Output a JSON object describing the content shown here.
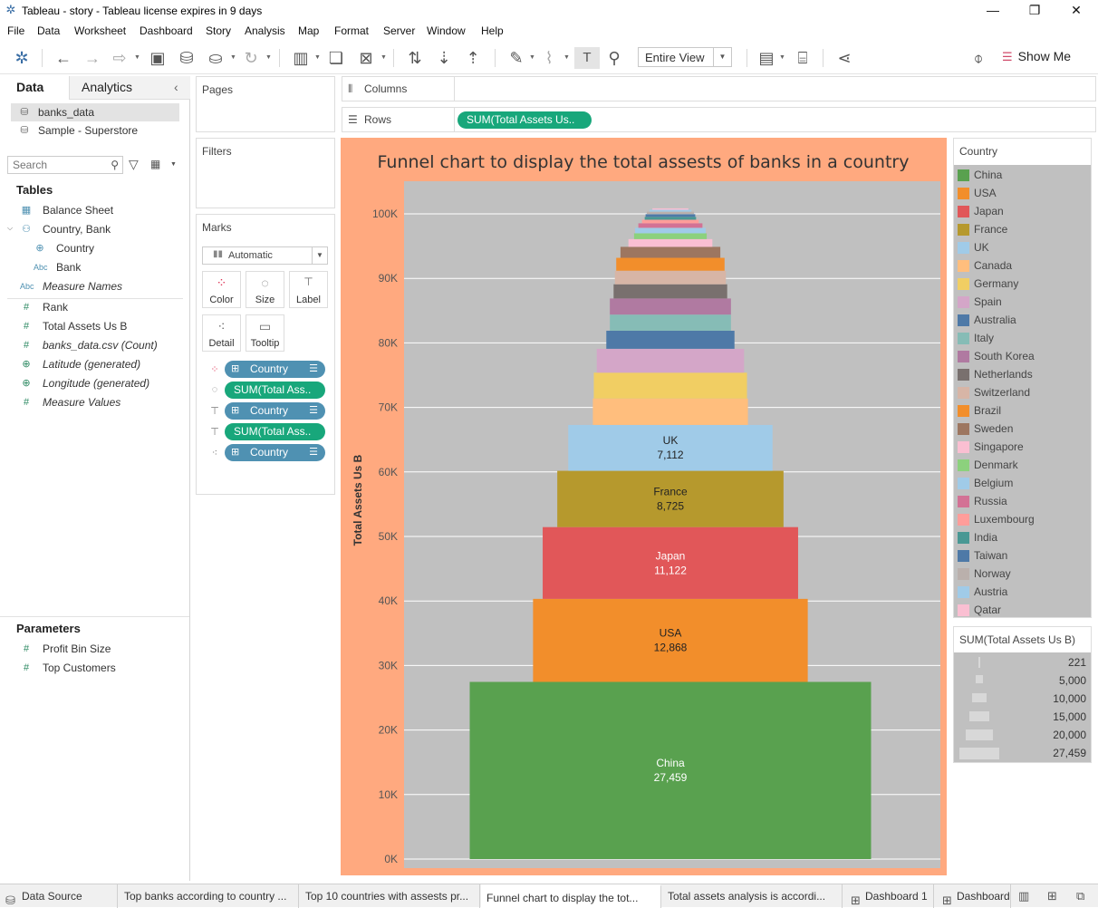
{
  "window": {
    "title": "Tableau - story - Tableau license expires in 9 days",
    "logo_icon": "tableau-logo-icon"
  },
  "menu": [
    "File",
    "Data",
    "Worksheet",
    "Dashboard",
    "Story",
    "Analysis",
    "Map",
    "Format",
    "Server",
    "Window",
    "Help"
  ],
  "toolbar": {
    "fit_value": "Entire View",
    "show_me": "Show Me"
  },
  "datapane": {
    "tabs": [
      "Data",
      "Analytics"
    ],
    "datasources": [
      "banks_data",
      "Sample - Superstore"
    ],
    "search_placeholder": "Search",
    "tables_title": "Tables",
    "fields": [
      {
        "label": "Balance Sheet",
        "icon": "table-icon",
        "italic": false
      },
      {
        "label": "Country, Bank",
        "icon": "hierarchy-icon",
        "italic": false
      },
      {
        "label": "Country",
        "icon": "globe-icon",
        "italic": false
      },
      {
        "label": "Bank",
        "icon": "abc-icon",
        "italic": false
      },
      {
        "label": "Measure Names",
        "icon": "abc-icon",
        "italic": true
      },
      {
        "label": "Rank",
        "icon": "number-icon",
        "italic": false
      },
      {
        "label": "Total Assets Us B",
        "icon": "number-icon",
        "italic": false
      },
      {
        "label": "banks_data.csv (Count)",
        "icon": "number-icon",
        "italic": true
      },
      {
        "label": "Latitude (generated)",
        "icon": "globe-icon",
        "italic": true
      },
      {
        "label": "Longitude (generated)",
        "icon": "globe-icon",
        "italic": true
      },
      {
        "label": "Measure Values",
        "icon": "number-icon",
        "italic": true
      }
    ],
    "parameters_title": "Parameters",
    "parameters": [
      "Profit Bin Size",
      "Top Customers"
    ]
  },
  "shelves": {
    "pages": "Pages",
    "filters": "Filters",
    "marks": "Marks",
    "columns": "Columns",
    "rows": "Rows",
    "rows_pill": "SUM(Total Assets Us..",
    "mark_type": "Automatic",
    "mark_buttons": [
      "Color",
      "Size",
      "Label",
      "Detail",
      "Tooltip"
    ],
    "mark_pills": [
      {
        "label": "Country",
        "kind": "blue",
        "icon": "color-icon"
      },
      {
        "label": "SUM(Total Ass..",
        "kind": "green",
        "icon": "size-icon"
      },
      {
        "label": "Country",
        "kind": "blue",
        "icon": "label-icon"
      },
      {
        "label": "SUM(Total Ass..",
        "kind": "green",
        "icon": "label-icon"
      },
      {
        "label": "Country",
        "kind": "blue",
        "icon": "detail-icon"
      }
    ]
  },
  "legend": {
    "title": "Country",
    "items": [
      {
        "name": "China",
        "color": "#59a14f"
      },
      {
        "name": "USA",
        "color": "#f28e2b"
      },
      {
        "name": "Japan",
        "color": "#e15759"
      },
      {
        "name": "France",
        "color": "#b6992d"
      },
      {
        "name": "UK",
        "color": "#a0cbe8"
      },
      {
        "name": "Canada",
        "color": "#ffbe7d"
      },
      {
        "name": "Germany",
        "color": "#f1ce63"
      },
      {
        "name": "Spain",
        "color": "#d4a6c8"
      },
      {
        "name": "Australia",
        "color": "#4e79a7"
      },
      {
        "name": "Italy",
        "color": "#86bcb6"
      },
      {
        "name": "South Korea",
        "color": "#b07aa1"
      },
      {
        "name": "Netherlands",
        "color": "#79706e"
      },
      {
        "name": "Switzerland",
        "color": "#d7b5a6"
      },
      {
        "name": "Brazil",
        "color": "#f28e2b"
      },
      {
        "name": "Sweden",
        "color": "#9d7660"
      },
      {
        "name": "Singapore",
        "color": "#fabfd2"
      },
      {
        "name": "Denmark",
        "color": "#8cd17d"
      },
      {
        "name": "Belgium",
        "color": "#a0cbe8"
      },
      {
        "name": "Russia",
        "color": "#d37295"
      },
      {
        "name": "Luxembourg",
        "color": "#ff9d9a"
      },
      {
        "name": "India",
        "color": "#499894"
      },
      {
        "name": "Taiwan",
        "color": "#4e79a7"
      },
      {
        "name": "Norway",
        "color": "#bab0ac"
      },
      {
        "name": "Austria",
        "color": "#a0cbe8"
      },
      {
        "name": "Qatar",
        "color": "#fabfd2"
      }
    ]
  },
  "size_legend": {
    "title": "SUM(Total Assets Us B)",
    "values": [
      "221",
      "5,000",
      "10,000",
      "15,000",
      "20,000",
      "27,459"
    ]
  },
  "colors": {
    "viz_background": "#ffa97f",
    "plot_background": "#c0c0c0",
    "pill_green": "#18a77b",
    "pill_blue": "#4f91b2"
  },
  "chart_data": {
    "type": "bar",
    "subtype": "funnel (stacked bars, width proportional to value)",
    "title": "Funnel chart to display the total assests of banks in a country",
    "ylabel": "Total Assets Us B",
    "ylim": [
      0,
      100000
    ],
    "yticks": [
      "0K",
      "10K",
      "20K",
      "30K",
      "40K",
      "50K",
      "60K",
      "70K",
      "80K",
      "90K",
      "100K"
    ],
    "categories": [
      "China",
      "USA",
      "Japan",
      "France",
      "UK",
      "Canada",
      "Germany",
      "Spain",
      "Australia",
      "Italy",
      "South Korea",
      "Netherlands",
      "Switzerland",
      "Brazil",
      "Sweden",
      "Singapore",
      "Denmark",
      "Belgium",
      "Russia",
      "Luxembourg",
      "India",
      "Taiwan",
      "Norway",
      "Austria",
      "Qatar"
    ],
    "values": [
      27459,
      12868,
      11122,
      8725,
      7112,
      4100,
      4000,
      3700,
      2800,
      2500,
      2500,
      2200,
      2100,
      2000,
      1700,
      1200,
      900,
      850,
      700,
      550,
      450,
      420,
      380,
      300,
      221
    ],
    "data_labels": [
      {
        "country": "China",
        "value": "27,459"
      },
      {
        "country": "USA",
        "value": "12,868"
      },
      {
        "country": "Japan",
        "value": "11,122"
      },
      {
        "country": "France",
        "value": "8,725"
      },
      {
        "country": "UK",
        "value": "7,112"
      }
    ],
    "grid": true,
    "legend": "right"
  },
  "tabs": {
    "data_source": "Data Source",
    "sheets": [
      "Top banks according to country ...",
      "Top 10 countries with assests pr...",
      "Funnel chart to display the tot...",
      "Total assets analysis is accordi...",
      "Dashboard 1",
      "Dashboard"
    ],
    "active_index": 2
  }
}
